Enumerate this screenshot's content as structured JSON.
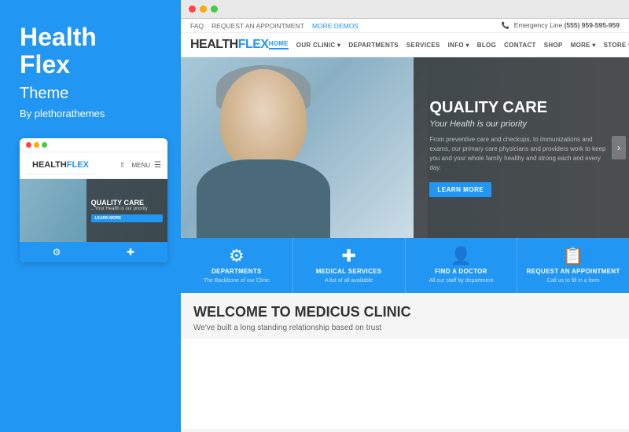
{
  "left": {
    "title_line1": "Health",
    "title_line2": "Flex",
    "subtitle": "Theme",
    "author": "By plethorathemes",
    "mobile": {
      "brand_black": "HEALTH",
      "brand_blue": "FLEX",
      "menu_label": "MENU",
      "hero_title": "QUALITY CARE",
      "hero_sub": "...Your Health is our priority",
      "hero_btn": "LEARN MORE"
    }
  },
  "right": {
    "topbar": {
      "faq": "FAQ",
      "appointment": "REQUEST AN APPOINTMENT",
      "more_demos": "MORE DEMOS",
      "emergency_label": "Emergency Line",
      "phone": "(555) 959-595-959"
    },
    "nav": {
      "brand_black": "HEALTH",
      "brand_blue": "FLEX",
      "links": [
        "HOME",
        "OUR CLINIC ↓",
        "DEPARTMENTS",
        "SERVICES",
        "INFO ↓",
        "BLOG",
        "CONTACT",
        "SHOP",
        "MORE ↓",
        "STORE ↓"
      ]
    },
    "hero": {
      "title": "QUALITY CARE",
      "subtitle": "Your Health is our priority",
      "body": "From preventive care and checkups, to immunizations and exams, our primary care physicians and providers work to keep you and your whole family healthy and strong each and every day.",
      "btn_label": "LEARN MORE"
    },
    "icons": [
      {
        "icon": "⚙",
        "label": "DEPARTMENTS",
        "desc": "The Backbone of our Clinic"
      },
      {
        "icon": "✚",
        "label": "MEDICAL SERVICES",
        "desc": "A list of all available"
      },
      {
        "icon": "👤",
        "label": "FIND A DOCTOR",
        "desc": "All our staff by department"
      },
      {
        "icon": "📋",
        "label": "REQUEST AN APPOINTMENT",
        "desc": "Call us to fill in a form"
      }
    ],
    "welcome": {
      "title": "WELCOME TO MEDICUS CLINIC",
      "text": "We've built a long standing relationship based on trust"
    }
  }
}
